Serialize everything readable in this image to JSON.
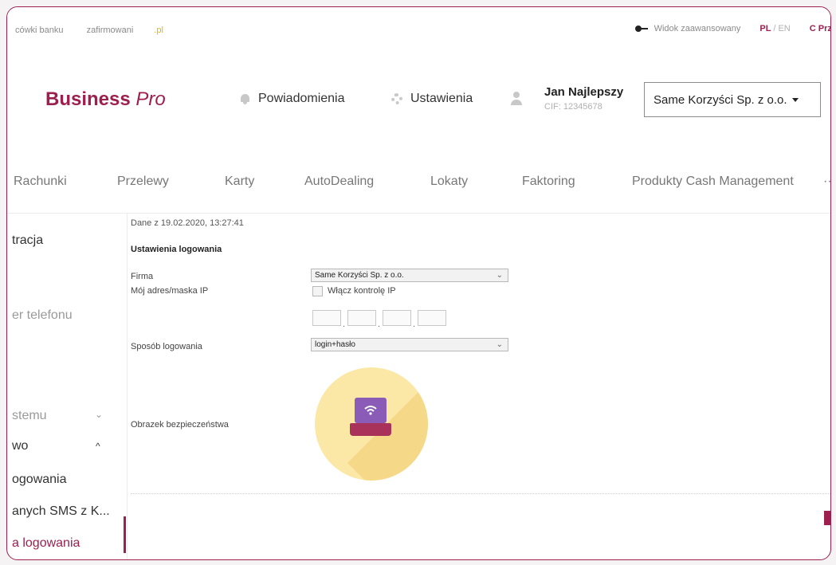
{
  "topbar": {
    "left_link_1": "cówki banku",
    "left_link_2_main": "zafirmowani",
    "left_link_2_accent": ".pl",
    "advanced_view": "Widok zaawansowany",
    "lang_pl": "PL",
    "lang_sep": "/",
    "lang_en": "EN",
    "refresh_label": "C Prze"
  },
  "header": {
    "logo_main": "Business",
    "logo_accent": "Pro",
    "notifications": "Powiadomienia",
    "settings": "Ustawienia",
    "user_name": "Jan Najlepszy",
    "user_cif": "CIF: 12345678",
    "company_selected": "Same Korzyści Sp. z o.o."
  },
  "mainnav": {
    "items": [
      "Rachunki",
      "Przelewy",
      "Karty",
      "AutoDealing",
      "Lokaty",
      "Faktoring",
      "Produkty Cash Management"
    ],
    "more": "··"
  },
  "sidebar": {
    "item_1": "tracja",
    "item_2": "er telefonu",
    "item_3": "stemu",
    "item_4": "wo",
    "item_5": "ogowania",
    "item_6": "anych SMS z K...",
    "item_7": "a logowania"
  },
  "content": {
    "data_date": "Dane z 19.02.2020, 13:27:41",
    "section_title": "Ustawienia logowania",
    "firma_label": "Firma",
    "firma_value": "Same Korzyści Sp. z o.o.",
    "ip_label": "Mój adres/maska IP",
    "ip_checkbox_label": "Włącz kontrolę IP",
    "login_method_label": "Sposób logowania",
    "login_method_value": "login+hasło",
    "security_image_label": "Obrazek bezpieczeństwa"
  },
  "colors": {
    "brand": "#9c1f4e",
    "accent_yellow": "#e1b800"
  }
}
